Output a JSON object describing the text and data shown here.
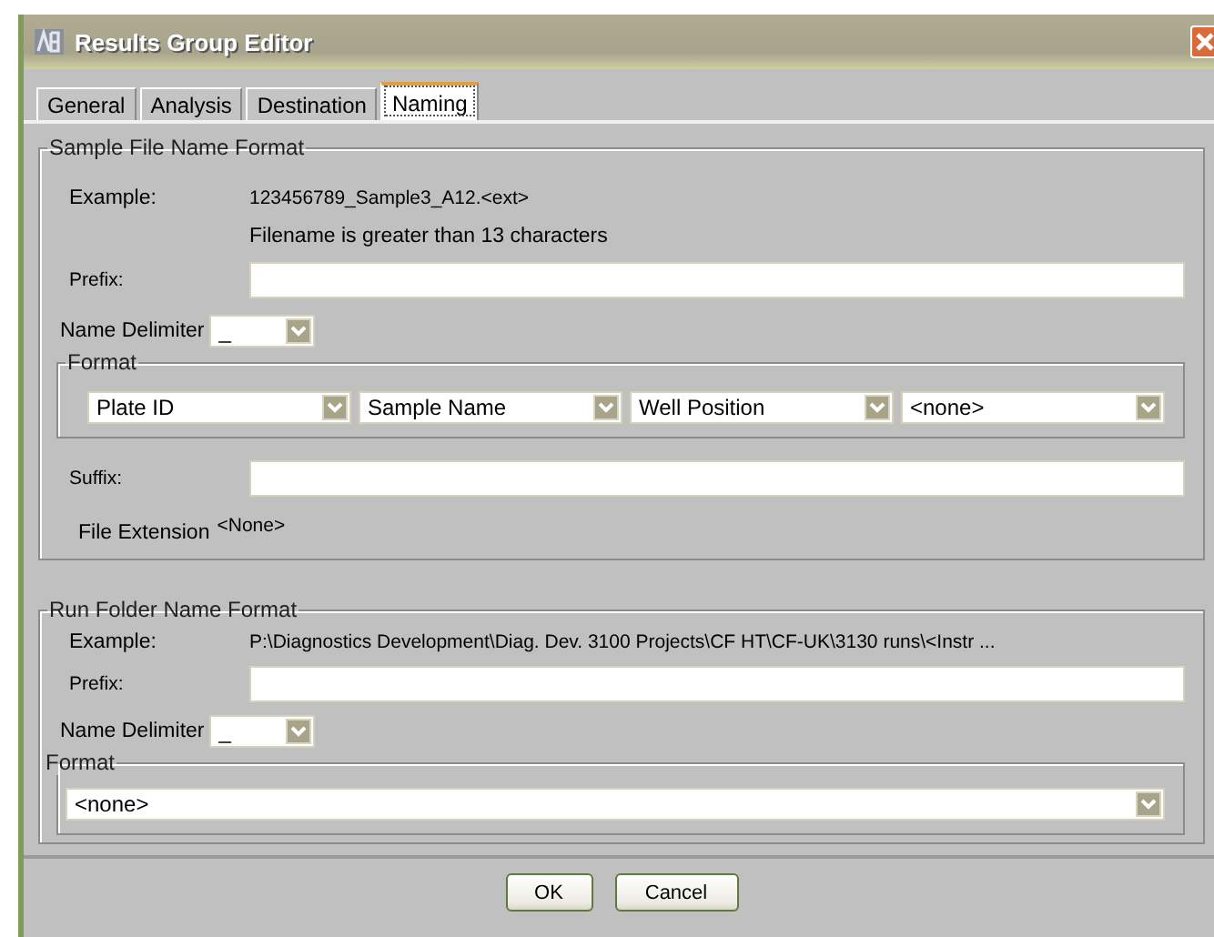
{
  "window": {
    "title": "Results Group Editor"
  },
  "tabs": [
    {
      "label": "General",
      "selected": false
    },
    {
      "label": "Analysis",
      "selected": false
    },
    {
      "label": "Destination",
      "selected": false
    },
    {
      "label": "Naming",
      "selected": true
    }
  ],
  "sample_file_name_format": {
    "title": "Sample File Name Format",
    "example_label": "Example:",
    "example": "123456789_Sample3_A12.<ext>",
    "warning": "Filename is greater than 13 characters",
    "prefix_label": "Prefix:",
    "delimiter_label": "Name Delimiter",
    "delimiter": "_",
    "format": {
      "title": "Format",
      "fields": [
        "Plate ID",
        "Sample Name",
        "Well Position",
        "<none>"
      ]
    },
    "suffix_label": "Suffix:",
    "file_extension_label": "File Extension",
    "file_extension": "<None>"
  },
  "run_folder_name_format": {
    "title": "Run Folder Name Format",
    "example_label": "Example:",
    "example": "P:\\Diagnostics Development\\Diag. Dev. 3100 Projects\\CF HT\\CF-UK\\3130 runs\\<Instr ...",
    "prefix_label": "Prefix:",
    "delimiter_label": "Name Delimiter",
    "delimiter": "_",
    "format": {
      "title": "Format",
      "fields": [
        "<none>"
      ]
    }
  },
  "buttons": [
    "OK",
    "Cancel"
  ]
}
